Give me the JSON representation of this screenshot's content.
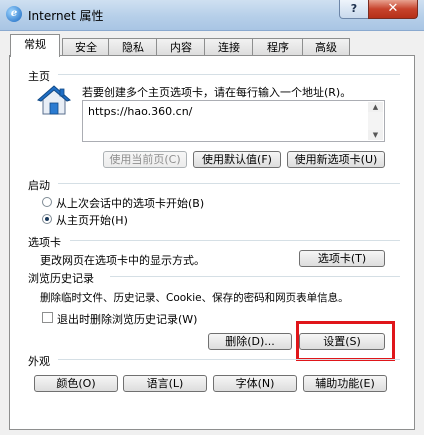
{
  "window": {
    "title": "Internet 属性",
    "help_label": "?",
    "close_label": "✕"
  },
  "tabs": [
    {
      "label": "常规",
      "active": true
    },
    {
      "label": "安全"
    },
    {
      "label": "隐私"
    },
    {
      "label": "内容"
    },
    {
      "label": "连接"
    },
    {
      "label": "程序"
    },
    {
      "label": "高级"
    }
  ],
  "homepage": {
    "section_label": "主页",
    "instruction": "若要创建多个主页选项卡，请在每行输入一个地址(R)。",
    "url": "https://hao.360.cn/",
    "buttons": {
      "use_current": "使用当前页(C)",
      "use_default": "使用默认值(F)",
      "use_new_tab": "使用新选项卡(U)"
    }
  },
  "startup": {
    "section_label": "启动",
    "options": [
      {
        "label": "从上次会话中的选项卡开始(B)",
        "checked": false
      },
      {
        "label": "从主页开始(H)",
        "checked": true
      }
    ]
  },
  "tabs_section": {
    "section_label": "选项卡",
    "description": "更改网页在选项卡中的显示方式。",
    "button": "选项卡(T)"
  },
  "history": {
    "section_label": "浏览历史记录",
    "description": "删除临时文件、历史记录、Cookie、保存的密码和网页表单信息。",
    "checkbox_label": "退出时删除浏览历史记录(W)",
    "delete_button": "删除(D)...",
    "settings_button": "设置(S)"
  },
  "appearance": {
    "section_label": "外观",
    "buttons": {
      "colors": "颜色(O)",
      "languages": "语言(L)",
      "fonts": "字体(N)",
      "accessibility": "辅助功能(E)"
    }
  },
  "colors": {
    "highlight": "#e0161a",
    "titlebar": "#b6cfe9"
  }
}
